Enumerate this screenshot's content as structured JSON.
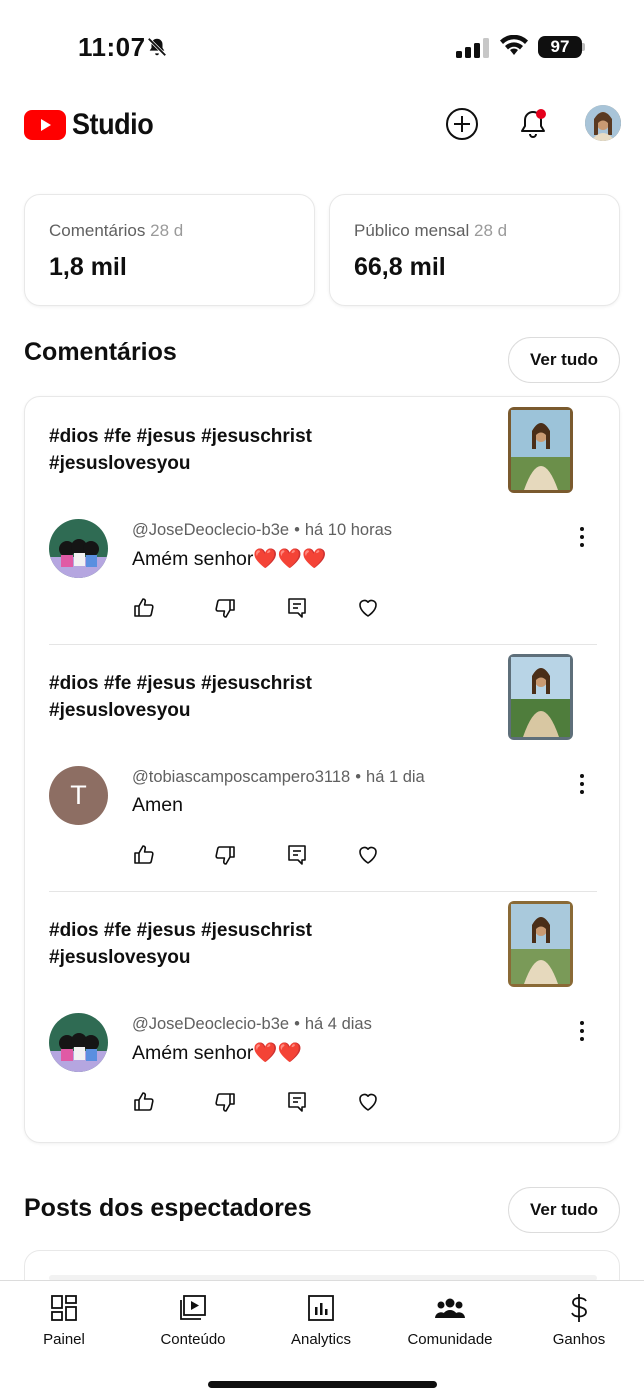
{
  "status_bar": {
    "time": "11:07",
    "battery": "97"
  },
  "header": {
    "brand": "Studio"
  },
  "stats": [
    {
      "label": "Comentários",
      "period": "28 d",
      "value": "1,8 mil"
    },
    {
      "label": "Público mensal",
      "period": "28 d",
      "value": "66,8 mil"
    }
  ],
  "comments_section": {
    "title": "Comentários",
    "see_all": "Ver tudo"
  },
  "comments": [
    {
      "video_title": "#dios #fe #jesus #jesuschrist #jesuslovesyou",
      "author": "@JoseDeoclecio-b3e",
      "time": "há 10 horas",
      "text": "Amém senhor❤️❤️❤️",
      "avatar_letter": ""
    },
    {
      "video_title": "#dios #fe #jesus #jesuschrist #jesuslovesyou",
      "author": "@tobiascamposcampero3118",
      "time": "há 1 dia",
      "text": "Amen",
      "avatar_letter": "T"
    },
    {
      "video_title": "#dios #fe #jesus #jesuschrist #jesuslovesyou",
      "author": "@JoseDeoclecio-b3e",
      "time": "há 4 dias",
      "text": "Amém senhor❤️❤️",
      "avatar_letter": ""
    }
  ],
  "posts_section": {
    "title": "Posts dos espectadores",
    "see_all": "Ver tudo"
  },
  "nav": [
    {
      "label": "Painel",
      "icon": "dashboard-icon"
    },
    {
      "label": "Conteúdo",
      "icon": "content-icon"
    },
    {
      "label": "Analytics",
      "icon": "analytics-icon"
    },
    {
      "label": "Comunidade",
      "icon": "community-icon"
    },
    {
      "label": "Ganhos",
      "icon": "earnings-icon"
    }
  ],
  "colors": {
    "brand_red": "#ff0000",
    "notification_dot": "#e5001c",
    "avatar_letter_bg": "#8d6e63"
  }
}
